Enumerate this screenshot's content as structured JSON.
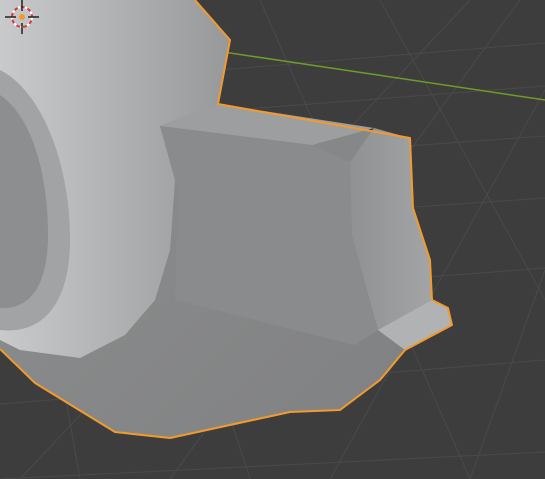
{
  "viewport": {
    "background_color": "#3d3d3d",
    "grid_color": "#4a4a4a",
    "x_axis_color": "#6f9b2a",
    "selection_outline_color": "#f39a2c"
  },
  "selected_object": {
    "state": "selected",
    "outline": "orange"
  },
  "cursor": {
    "icon": "3d-cursor-icon"
  }
}
